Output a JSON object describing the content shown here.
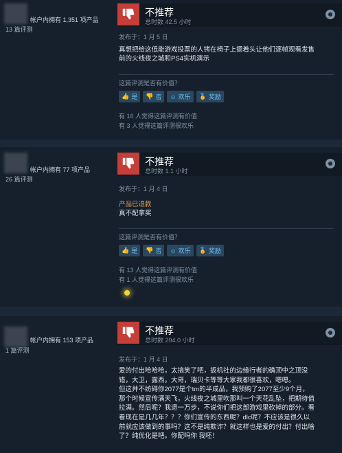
{
  "reviews": [
    {
      "owned": "帐户内拥有 1,351 项产品",
      "count": "13 篇评测",
      "vote": "不推荐",
      "hours": "总时数 42.5 小时",
      "posted": "发布于：1 月 5 日",
      "refund": "",
      "text": [
        "真想把给这低能游戏投票的人铐在椅子上摁着头让他们逐帧观看发售",
        "前的火线夜之城和PS4实机演示"
      ],
      "helpful_q": "这篇评测是否有价值？",
      "buttons": {
        "yes": "是",
        "no": "否",
        "funny": "欢乐",
        "award": "奖励"
      },
      "found_helpful": "有 16 人觉得这篇评测有价值",
      "found_funny": "有 3 人觉得这篇评测很欢乐"
    },
    {
      "owned": "帐户内拥有 77 项产品",
      "count": "26 篇评测",
      "vote": "不推荐",
      "hours": "总时数 1.1 小时",
      "posted": "发布于：1 月 4 日",
      "refund": "产品已退款",
      "text": [
        "真不配拿奖"
      ],
      "helpful_q": "这篇评测是否有价值？",
      "buttons": {
        "yes": "是",
        "no": "否",
        "funny": "欢乐",
        "award": "奖励"
      },
      "found_helpful": "有 13 人觉得这篇评测有价值",
      "found_funny": "有 1 人觉得这篇评测很欢乐"
    },
    {
      "owned": "帐户内拥有 153 项产品",
      "count": "1 篇评测",
      "vote": "不推荐",
      "hours": "总时数 204.0 小时",
      "posted": "发布于：1 月 4 日",
      "refund": "",
      "text": [
        "爱的付出哈哈哈，太搞笑了吧，扳机社的边缘行者的确顶中之顶没",
        "错，大卫，露西，大哥，瑞贝卡等等大家我都很喜欢，嗯嗯。",
        "但这并不妨碍你2077是个tm的半成品，我预购了2077至少9个月，",
        "那个时候宣传满天飞，火线夜之城里吹那叫一个天花乱坠，把期待值",
        "拉满。然后呢？我退一万步，不说你们把这部游戏里砍掉的部分。看",
        "看现在是几几年？？？你们宣传的东西呢？dlc呢？不应该是很久以",
        "前就应该做到的事吗？这不是纯欺诈？就这样也是爱的付出？付出啥",
        "了？纯优化是吧。你配吗你 我呸！"
      ]
    }
  ],
  "colors": {
    "thumb_down": "#c53e37",
    "link": "#67c1f5",
    "refund": "#e2a257"
  }
}
